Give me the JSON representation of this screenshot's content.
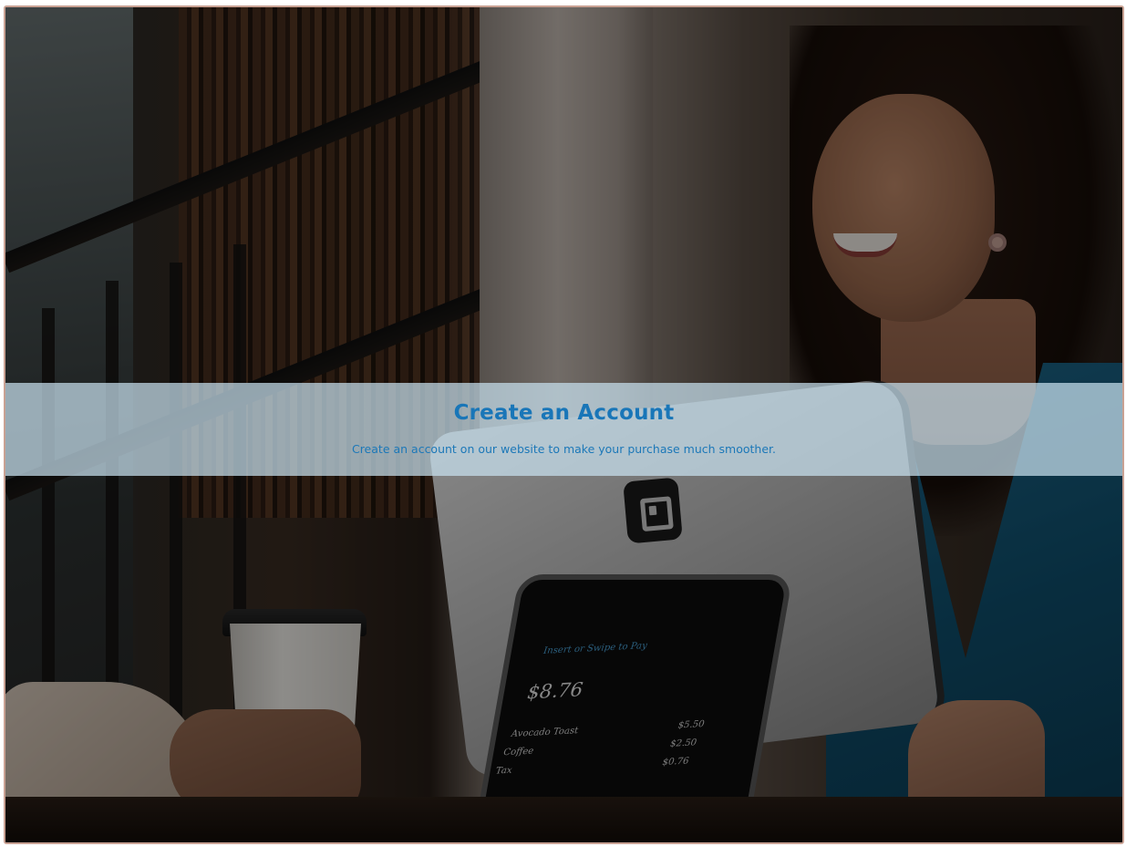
{
  "banner": {
    "title": "Create an Account",
    "subtitle": "Create an account on our website to make your purchase much smoother."
  },
  "pos_screen": {
    "prompt": "Insert or Swipe to Pay",
    "total": "$8.76",
    "items": [
      {
        "name": "Avocado Toast",
        "price": "$5.50"
      },
      {
        "name": "Coffee",
        "price": "$2.50"
      },
      {
        "name": "Tax",
        "price": "$0.76"
      }
    ]
  },
  "colors": {
    "title": "#1976b8",
    "banner_bg": "rgba(200,224,238,0.72)",
    "frame_border": "#c9a193"
  },
  "icons": {
    "reader_logo": "square-logo-icon"
  }
}
